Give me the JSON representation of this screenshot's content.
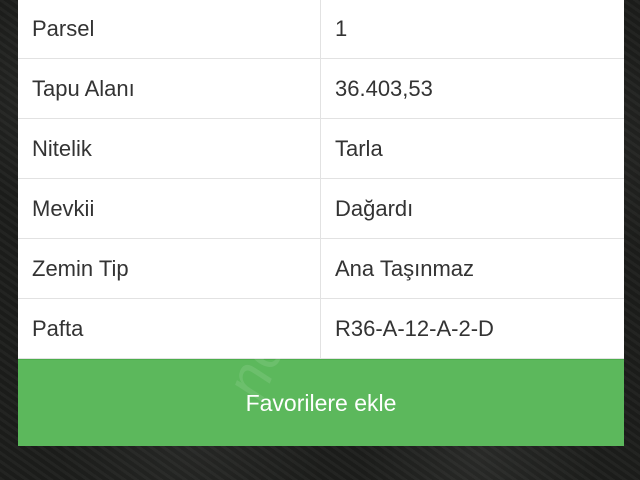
{
  "details": [
    {
      "label": "Parsel",
      "value": "1"
    },
    {
      "label": "Tapu Alanı",
      "value": "36.403,53"
    },
    {
      "label": "Nitelik",
      "value": "Tarla"
    },
    {
      "label": "Mevkii",
      "value": "Dağardı"
    },
    {
      "label": "Zemin Tip",
      "value": "Ana Taşınmaz"
    },
    {
      "label": "Pafta",
      "value": "R36-A-12-A-2-D"
    }
  ],
  "actions": {
    "favorite_label": "Favorilere ekle"
  },
  "colors": {
    "button_green": "#5cb85c",
    "text": "#333333",
    "border": "#e2e2e2"
  }
}
